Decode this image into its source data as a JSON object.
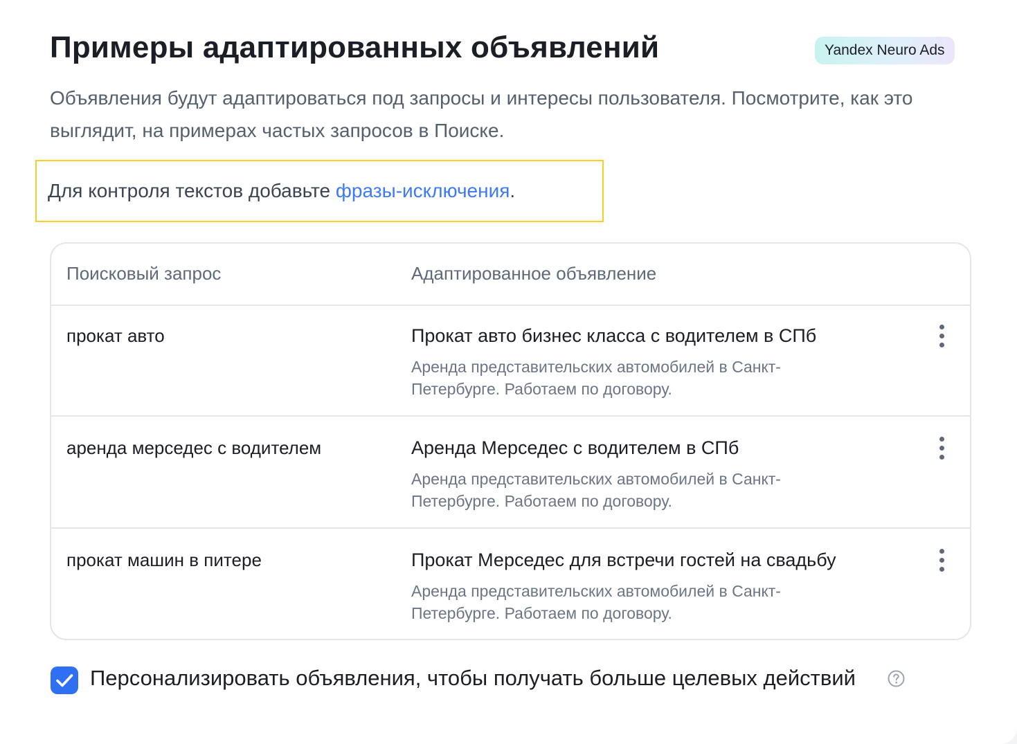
{
  "header": {
    "title": "Примеры адаптированных объявлений",
    "badge": "Yandex Neuro Ads",
    "subtitle": "Объявления будут адаптироваться под запросы и интересы пользователя. Посмотрите, как это выглядит, на примерах частых запросов в Поиске."
  },
  "notice": {
    "text_before": "Для контроля текстов добавьте ",
    "link": "фразы-исключения",
    "text_after": "."
  },
  "table": {
    "columns": [
      "Поисковый запрос",
      "Адаптированное объявление"
    ],
    "rows": [
      {
        "query": "прокат авто",
        "ad_title": "Прокат авто бизнес класса с водителем в СПб",
        "ad_text": "Аренда представительских автомобилей в Санкт-Петербурге. Работаем по договору."
      },
      {
        "query": "аренда мерседес с водителем",
        "ad_title": "Аренда Мерседес с водителем в СПб",
        "ad_text": "Аренда представительских автомобилей в Санкт-Петербурге. Работаем по договору."
      },
      {
        "query": "прокат машин в питере",
        "ad_title": "Прокат Мерседес для встречи гостей на свадьбу",
        "ad_text": "Аренда представительских автомобилей в Санкт-Петербурге. Работаем по договору."
      }
    ],
    "row_menu_icon": "more-vertical-icon"
  },
  "personalize": {
    "checked": true,
    "label": "Персонализировать объявления, чтобы получать больше целевых действий",
    "help_icon": "question-circle-icon"
  },
  "colors": {
    "accent": "#2f6ff2",
    "link": "#3e7af6",
    "highlight_border": "#f6cd2a"
  }
}
